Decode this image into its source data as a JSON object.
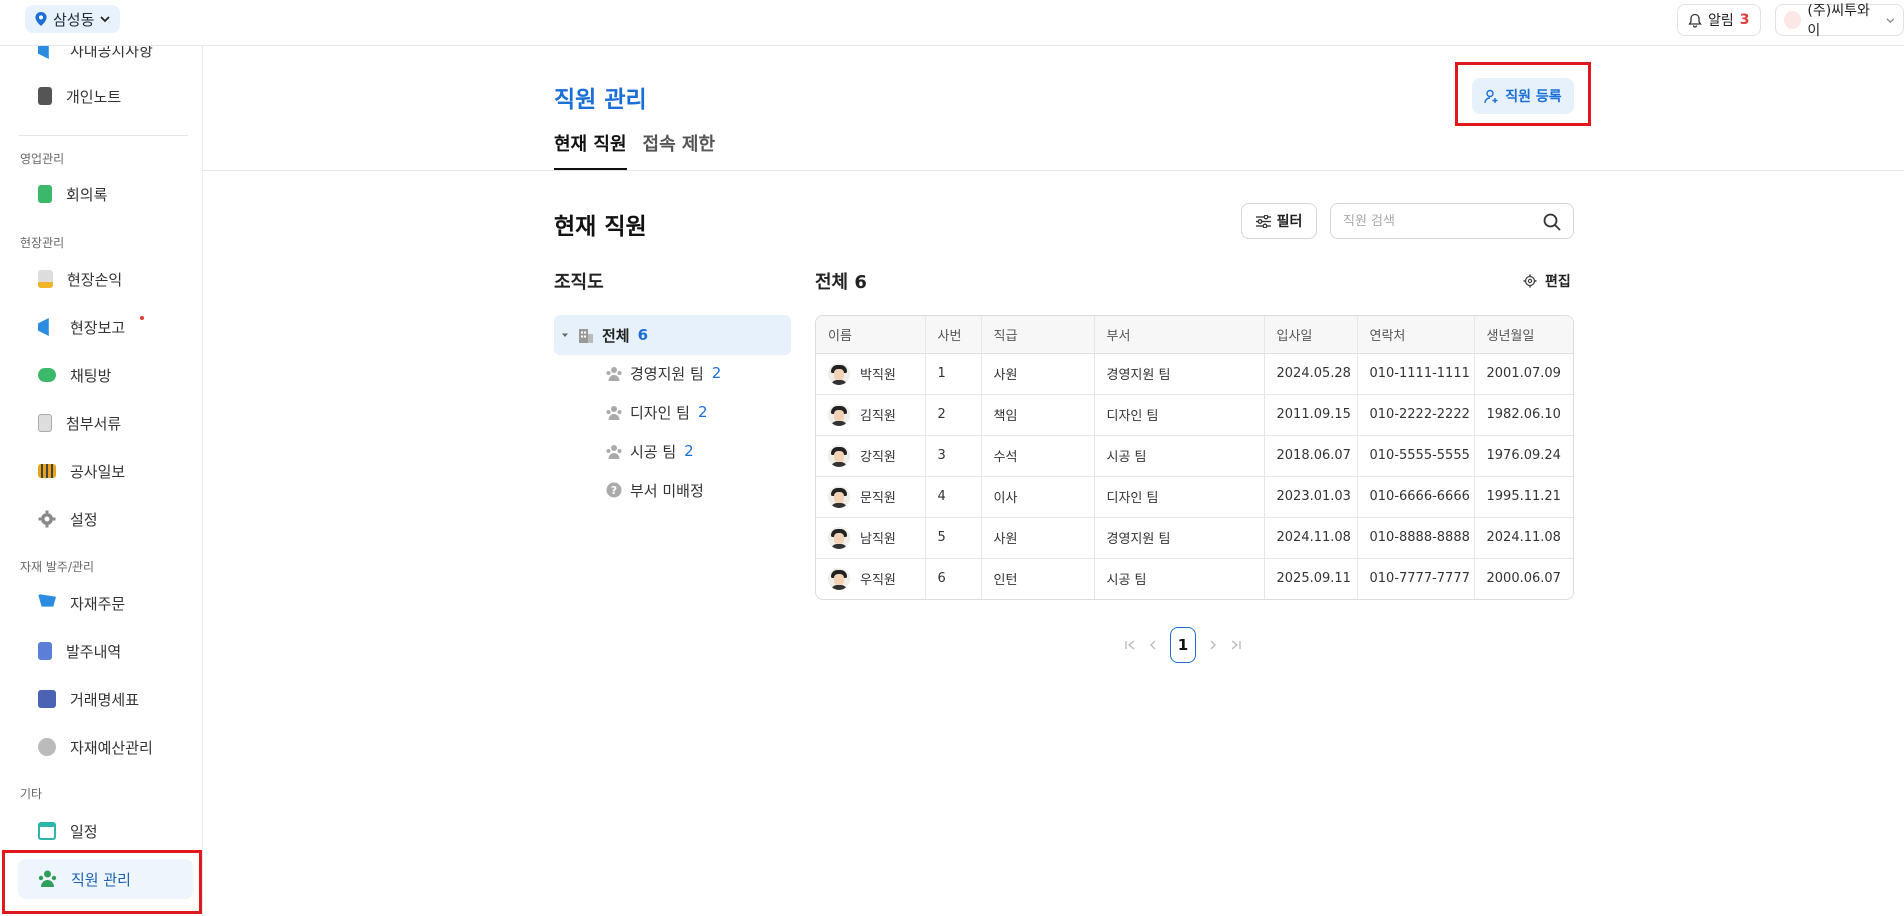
{
  "topbar": {
    "location": "삼성동",
    "notif_label": "알림",
    "notif_count": "3",
    "company": "(주)씨투와이"
  },
  "sidebar": {
    "top_items": [
      {
        "label": "사내공지사항",
        "icon": "megaphone-icon"
      },
      {
        "label": "개인노트",
        "icon": "notebook-icon"
      }
    ],
    "groups": [
      {
        "title": "영업관리",
        "items": [
          {
            "label": "회의록",
            "icon": "minutes-icon"
          }
        ]
      },
      {
        "title": "현장관리",
        "items": [
          {
            "label": "현장손익",
            "icon": "profit-icon"
          },
          {
            "label": "현장보고",
            "icon": "report-icon"
          },
          {
            "label": "채팅방",
            "icon": "chat-icon"
          },
          {
            "label": "첨부서류",
            "icon": "attachment-icon"
          },
          {
            "label": "공사일보",
            "icon": "construction-log-icon"
          },
          {
            "label": "설정",
            "icon": "gear-icon"
          }
        ]
      },
      {
        "title": "자재 발주/관리",
        "items": [
          {
            "label": "자재주문",
            "icon": "cart-icon"
          },
          {
            "label": "발주내역",
            "icon": "order-history-icon"
          },
          {
            "label": "거래명세표",
            "icon": "statement-icon"
          },
          {
            "label": "자재예산관리",
            "icon": "budget-icon"
          }
        ]
      },
      {
        "title": "기타",
        "items": [
          {
            "label": "일정",
            "icon": "calendar-icon"
          },
          {
            "label": "직원 관리",
            "icon": "staff-icon"
          }
        ]
      }
    ]
  },
  "page": {
    "title": "직원 관리",
    "register_label": "직원 등록",
    "tabs": [
      "현재 직원",
      "접속 제한"
    ],
    "section_title": "현재 직원",
    "filter_label": "필터",
    "search_placeholder": "직원 검색"
  },
  "org": {
    "title": "조직도",
    "root": {
      "label": "전체",
      "count": "6"
    },
    "teams": [
      {
        "label": "경영지원 팀",
        "count": "2"
      },
      {
        "label": "디자인 팀",
        "count": "2"
      },
      {
        "label": "시공 팀",
        "count": "2"
      }
    ],
    "unassigned": "부서 미배정"
  },
  "table": {
    "total_label": "전체",
    "total_count": "6",
    "edit_label": "편집",
    "columns": [
      "이름",
      "사번",
      "직급",
      "부서",
      "입사일",
      "연락처",
      "생년월일"
    ],
    "rows": [
      [
        "박직원",
        "1",
        "사원",
        "경영지원 팀",
        "2024.05.28",
        "010-1111-1111",
        "2001.07.09"
      ],
      [
        "김직원",
        "2",
        "책임",
        "디자인 팀",
        "2011.09.15",
        "010-2222-2222",
        "1982.06.10"
      ],
      [
        "강직원",
        "3",
        "수석",
        "시공 팀",
        "2018.06.07",
        "010-5555-5555",
        "1976.09.24"
      ],
      [
        "문직원",
        "4",
        "이사",
        "디자인 팀",
        "2023.01.03",
        "010-6666-6666",
        "1995.11.21"
      ],
      [
        "남직원",
        "5",
        "사원",
        "경영지원 팀",
        "2024.11.08",
        "010-8888-8888",
        "2024.11.08"
      ],
      [
        "우직원",
        "6",
        "인턴",
        "시공 팀",
        "2025.09.11",
        "010-7777-7777",
        "2000.06.07"
      ]
    ]
  },
  "pagination": {
    "current": "1"
  },
  "colors": {
    "accent": "#1a6fd6",
    "highlight": "#e0181b",
    "selected_bg": "#e7f1fc"
  }
}
